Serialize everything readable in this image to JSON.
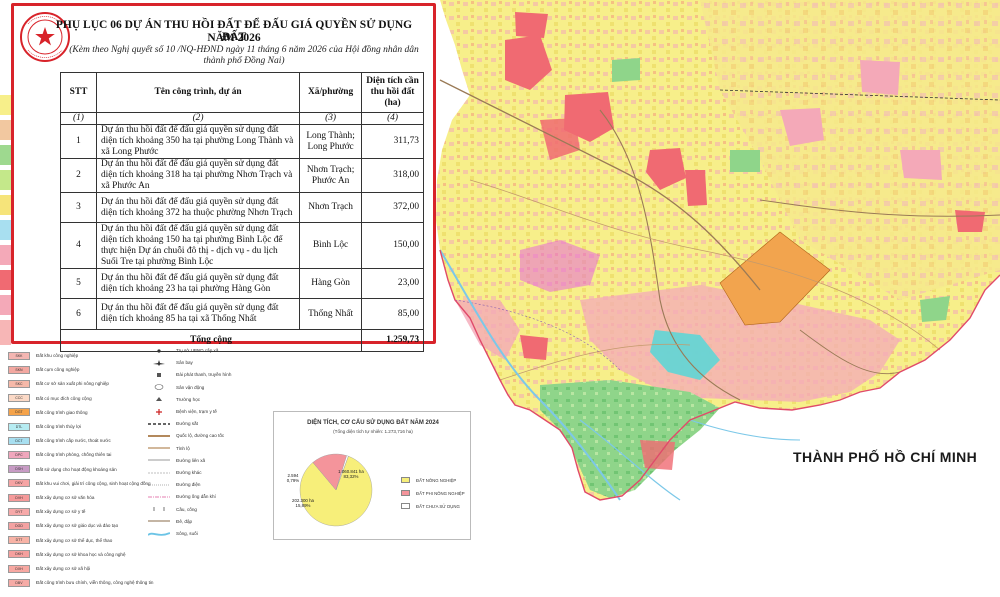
{
  "panel": {
    "heading_line1": "PHỤ LỤC 06 DỰ ÁN THU HỒI ĐẤT ĐỂ ĐẤU GIÁ QUYỀN SỬ DỤNG ĐẤT",
    "heading_line2": "NĂM 2026",
    "subtitle_line1": "(Kèm theo Nghị quyết số 10 /NQ-HĐND ngày 11 tháng 6 năm 2026 của Hội đồng nhân dân",
    "subtitle_line2": "thành phố Đồng Nai)",
    "seal_text": "HỘI ĐỒNG NHÂN DÂN THÀNH PHỐ ĐỒNG NAI",
    "columns": {
      "stt": "STT",
      "name": "Tên công trình, dự án",
      "ward": "Xã/phường",
      "area": "Diện tích cần thu hồi đất (ha)"
    },
    "column_index": [
      "(1)",
      "(2)",
      "(3)",
      "(4)"
    ],
    "rows": [
      {
        "stt": "1",
        "name": "Dự án thu hồi đất để đấu giá quyền sử dụng đất diện tích khoảng 350 ha tại phường Long Thành và xã Long Phước",
        "ward": "Long Thành; Long Phước",
        "area": "311,73"
      },
      {
        "stt": "2",
        "name": "Dự án thu hồi đất để đấu giá quyền sử dụng đất diện tích khoảng 318 ha tại phường Nhơn Trạch và xã Phước An",
        "ward": "Nhơn Trạch; Phước An",
        "area": "318,00"
      },
      {
        "stt": "3",
        "name": "Dự án thu hồi đất để đấu giá quyền sử dụng đất diện tích khoảng 372 ha thuộc phường Nhơn Trạch",
        "ward": "Nhơn Trạch",
        "area": "372,00"
      },
      {
        "stt": "4",
        "name": "Dự án thu hồi đất để đấu giá quyền sử dụng đất diện tích khoảng 150 ha tại phường Bình Lộc để thực hiện Dự án chuỗi đô thị - dịch vụ - du lịch Suối Tre tại phường Bình Lộc",
        "ward": "Bình Lộc",
        "area": "150,00"
      },
      {
        "stt": "5",
        "name": "Dự án thu hồi đất để đấu giá quyền sử dụng đất diện tích khoảng 23 ha tại phường Hàng Gòn",
        "ward": "Hàng Gòn",
        "area": "23,00"
      },
      {
        "stt": "6",
        "name": "Dự án thu hồi đất để đấu giá quyền sử dụng đất diện tích khoảng 85 ha tại xã Thống Nhất",
        "ward": "Thống Nhất",
        "area": "85,00"
      }
    ],
    "total_label": "Tổng cộng",
    "total_value": "1.259,73"
  },
  "map": {
    "neighbor_label": "THÀNH PHỐ HỒ CHÍ MINH",
    "colors": {
      "agri_yellow": "#f7ef8a",
      "residential_pink": "#f4a9b8",
      "urban_red": "#f06a72",
      "forest_green": "#8fd58a",
      "water_blue": "#8fd3ee",
      "airport_orange": "#f2a44e",
      "cyan": "#5fd6d6",
      "magenta": "#e868d8",
      "border_red": "#d8232a"
    }
  },
  "legend": {
    "col1": [
      {
        "code": "SKK",
        "label": "Đất khu công nghiệp",
        "color": "#f4b6b2"
      },
      {
        "code": "SKN",
        "label": "Đất cụm công nghiệp",
        "color": "#f3a8a1"
      },
      {
        "code": "SKC",
        "label": "Đất cơ sở sản xuất phi nông nghiệp",
        "color": "#f6b9a9"
      },
      {
        "code": "CCC",
        "label": "Đất có mục đích công cộng",
        "color": "#fbd9c6"
      },
      {
        "code": "DGT",
        "label": "Đất công trình giao thông",
        "color": "#f5a34a"
      },
      {
        "code": "DTL",
        "label": "Đất công trình thủy lợi",
        "color": "#b6ecf2"
      },
      {
        "code": "DCT",
        "label": "Đất công trình cấp nước, thoát nước",
        "color": "#a8dff0"
      },
      {
        "code": "DPC",
        "label": "Đất công trình phòng, chống thiên tai",
        "color": "#f0a7bd"
      },
      {
        "code": "DSH",
        "label": "Đất sử dụng cho hoạt động khoáng sản",
        "color": "#c79bc4"
      },
      {
        "code": "DKV",
        "label": "Đất khu vui chơi, giải trí công cộng, sinh hoạt cộng đồng",
        "color": "#f6a4a4"
      },
      {
        "code": "DVH",
        "label": "Đất xây dựng cơ sở văn hóa",
        "color": "#f59a9a"
      },
      {
        "code": "DYT",
        "label": "Đất xây dựng cơ sở y tế",
        "color": "#f7a9a9"
      },
      {
        "code": "DGD",
        "label": "Đất xây dựng cơ sở giáo dục và đào tạo",
        "color": "#f4a2a2"
      },
      {
        "code": "DTT",
        "label": "Đất xây dựng cơ sở thể dục, thể thao",
        "color": "#f8b3a6"
      },
      {
        "code": "DKH",
        "label": "Đất xây dựng cơ sở khoa học và công nghệ",
        "color": "#f5a09e"
      },
      {
        "code": "DXH",
        "label": "Đất xây dựng cơ sở xã hội",
        "color": "#f7a8a2"
      },
      {
        "code": "DBV",
        "label": "Đất công trình bưu chính, viễn thông, công nghệ thông tin",
        "color": "#f6aba6"
      }
    ],
    "col2": [
      {
        "label": "Trụ sở UBND cấp xã"
      },
      {
        "label": "Sân bay"
      },
      {
        "label": "Đài phát thanh, truyền hình"
      },
      {
        "label": "Sân vận động"
      },
      {
        "label": "Trường học"
      },
      {
        "label": "Bệnh viện, trạm y tế"
      },
      {
        "label": "Đường sắt"
      },
      {
        "label": "Quốc lộ, đường cao tốc"
      },
      {
        "label": "Tỉnh lộ"
      },
      {
        "label": "Đường liên xã"
      },
      {
        "label": "Đường khác"
      },
      {
        "label": "Đường điện"
      },
      {
        "label": "Đường ống dẫn khí"
      },
      {
        "label": "Cầu, cống"
      },
      {
        "label": "Đê, đập"
      },
      {
        "label": "Sông, suối"
      }
    ]
  },
  "pie": {
    "title": "DIỆN TÍCH, CƠ CẤU SỬ DỤNG ĐẤT NĂM 2024",
    "subtitle": "(Tổng diện tích tự nhiên: 1.273,716 ha)",
    "slices": [
      {
        "label": "ĐẤT NÔNG NGHIỆP",
        "value": 1060.841,
        "value_text": "1.060.841 ha",
        "pct_text": "83,32%",
        "color": "#f7ef7a"
      },
      {
        "label": "ĐẤT PHI NÔNG NGHIỆP",
        "value": 202.3,
        "value_text": "202.300 ha",
        "pct_text": "15,89%",
        "color": "#f4949b"
      },
      {
        "label": "ĐẤT CHƯA SỬ DỤNG",
        "value": 10.1,
        "value_text": "2.594",
        "pct_text": "0,79%",
        "color": "#ffffff"
      }
    ]
  }
}
